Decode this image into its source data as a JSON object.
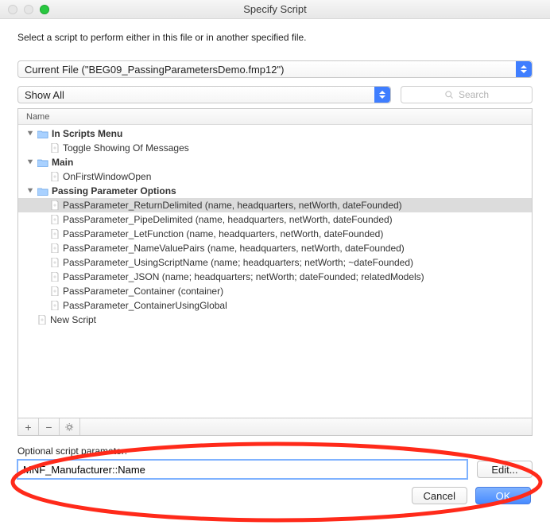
{
  "window": {
    "title": "Specify Script"
  },
  "instruction": "Select a script to perform either in this file or in another specified file.",
  "fileDropdown": {
    "label": "Current File (\"BEG09_PassingParametersDemo.fmp12\")"
  },
  "filterDropdown": {
    "label": "Show All"
  },
  "search": {
    "placeholder": "Search"
  },
  "listHeader": {
    "name": "Name"
  },
  "tree": {
    "groups": [
      {
        "label": "In Scripts Menu",
        "items": [
          {
            "label": "Toggle Showing Of Messages",
            "selected": false
          }
        ]
      },
      {
        "label": "Main",
        "items": [
          {
            "label": "OnFirstWindowOpen",
            "selected": false
          }
        ]
      },
      {
        "label": "Passing Parameter Options",
        "items": [
          {
            "label": "PassParameter_ReturnDelimited (name, headquarters, netWorth, dateFounded)",
            "selected": true
          },
          {
            "label": "PassParameter_PipeDelimited (name, headquarters, netWorth, dateFounded)",
            "selected": false
          },
          {
            "label": "PassParameter_LetFunction (name, headquarters, netWorth, dateFounded)",
            "selected": false
          },
          {
            "label": "PassParameter_NameValuePairs (name, headquarters, netWorth, dateFounded)",
            "selected": false
          },
          {
            "label": "PassParameter_UsingScriptName (name; headquarters; netWorth; ~dateFounded)",
            "selected": false
          },
          {
            "label": "PassParameter_JSON (name; headquarters; netWorth; dateFounded; relatedModels)",
            "selected": false
          },
          {
            "label": "PassParameter_Container (container)",
            "selected": false
          },
          {
            "label": "PassParameter_ContainerUsingGlobal",
            "selected": false
          }
        ]
      }
    ],
    "loose": [
      {
        "label": "New Script",
        "selected": false
      }
    ]
  },
  "toolbar": {
    "plus": "+",
    "minus": "−"
  },
  "param": {
    "label": "Optional script parameter:",
    "value": "MNF_Manufacturer::Name",
    "editLabel": "Edit..."
  },
  "buttons": {
    "cancel": "Cancel",
    "ok": "OK"
  }
}
